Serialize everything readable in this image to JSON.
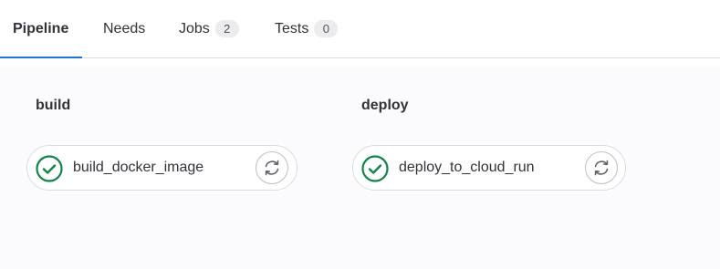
{
  "tabs": [
    {
      "label": "Pipeline"
    },
    {
      "label": "Needs"
    },
    {
      "label": "Jobs",
      "count": "2"
    },
    {
      "label": "Tests",
      "count": "0"
    }
  ],
  "stages": [
    {
      "title": "build",
      "job": {
        "name": "build_docker_image",
        "status": "passed",
        "icon": "check-circle-icon",
        "action_icon": "retry-icon"
      }
    },
    {
      "title": "deploy",
      "job": {
        "name": "deploy_to_cloud_run",
        "status": "passed",
        "icon": "check-circle-icon",
        "action_icon": "retry-icon"
      }
    }
  ],
  "colors": {
    "success": "#108548",
    "active_tab": "#1f75cb"
  }
}
